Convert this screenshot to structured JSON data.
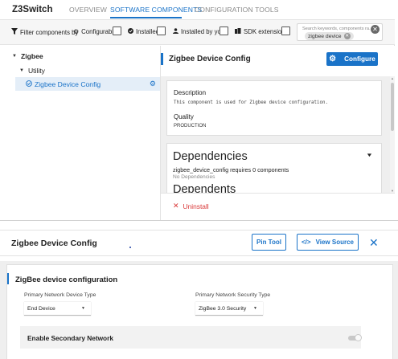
{
  "app": {
    "title": "Z3Switch",
    "tabs": [
      {
        "label": "OVERVIEW",
        "active": false
      },
      {
        "label": "SOFTWARE COMPONENTS",
        "active": true
      },
      {
        "label": "CONFIGURATION TOOLS",
        "active": false
      }
    ]
  },
  "filters": {
    "label": "Filter components by",
    "configurable": "Configurable",
    "installed": "Installed",
    "installed_by_you": "Installed by you",
    "sdk_extensions": "SDK extensions",
    "search_placeholder": "Search keywords, components ra...",
    "search_chip": "zigbee device"
  },
  "tree": {
    "root": "Zigbee",
    "group": "Utility",
    "item": "Zigbee Device Config"
  },
  "detail": {
    "title": "Zigbee Device Config",
    "configure_label": "Configure",
    "description_label": "Description",
    "description_text": "This component is used for Zigbee device configuration.",
    "quality_label": "Quality",
    "quality_value": "PRODUCTION",
    "dependencies_title": "Dependencies",
    "dependencies_text": "zigbee_device_config requires 0 components",
    "no_dependencies": "No Dependencies",
    "dependents_title": "Dependents",
    "uninstall_label": "Uninstall"
  },
  "bottom": {
    "title": "Zigbee Device Config",
    "pin_tool": "Pin Tool",
    "view_source": "View Source",
    "config_title": "ZigBee device configuration",
    "primary_type_label": "Primary Network Device Type",
    "primary_type_value": "End Device",
    "primary_security_label": "Primary Network Security Type",
    "primary_security_value": "ZigBee 3.0 Security",
    "secondary_label": "Enable Secondary Network",
    "secondary_enabled": false
  },
  "colors": {
    "accent": "#1a73c8",
    "danger": "#d93838"
  }
}
